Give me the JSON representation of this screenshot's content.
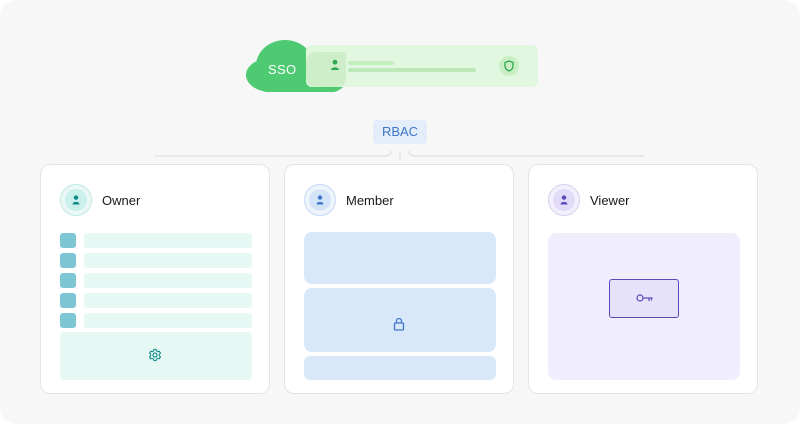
{
  "sso": {
    "label": "SSO",
    "icons": [
      "user-icon",
      "shield-icon"
    ],
    "colors": {
      "cloud": "#4ecb72",
      "strip": "#e1f7df"
    }
  },
  "rbac": {
    "label": "RBAC",
    "color": "#3f77c9"
  },
  "roles": [
    {
      "name": "Owner",
      "icon": "user-icon",
      "accent": "#0f8a8a",
      "panel_icon": "gear-icon",
      "row_count": 5
    },
    {
      "name": "Member",
      "icon": "user-icon",
      "accent": "#3f77c9",
      "panel_icon": "lock-icon"
    },
    {
      "name": "Viewer",
      "icon": "user-icon",
      "accent": "#5b4bb8",
      "panel_icon": "key-icon"
    }
  ]
}
